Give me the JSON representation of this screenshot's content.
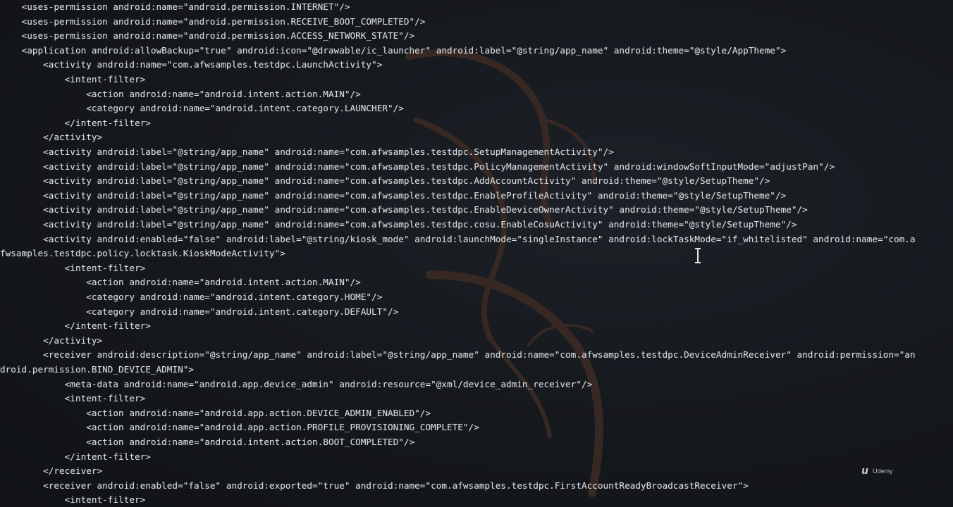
{
  "terminal": {
    "lines": [
      "    <uses-permission android:name=\"android.permission.INTERNET\"/>",
      "    <uses-permission android:name=\"android.permission.RECEIVE_BOOT_COMPLETED\"/>",
      "    <uses-permission android:name=\"android.permission.ACCESS_NETWORK_STATE\"/>",
      "    <application android:allowBackup=\"true\" android:icon=\"@drawable/ic_launcher\" android:label=\"@string/app_name\" android:theme=\"@style/AppTheme\">",
      "        <activity android:name=\"com.afwsamples.testdpc.LaunchActivity\">",
      "            <intent-filter>",
      "                <action android:name=\"android.intent.action.MAIN\"/>",
      "                <category android:name=\"android.intent.category.LAUNCHER\"/>",
      "            </intent-filter>",
      "        </activity>",
      "        <activity android:label=\"@string/app_name\" android:name=\"com.afwsamples.testdpc.SetupManagementActivity\"/>",
      "        <activity android:label=\"@string/app_name\" android:name=\"com.afwsamples.testdpc.PolicyManagementActivity\" android:windowSoftInputMode=\"adjustPan\"/>",
      "        <activity android:label=\"@string/app_name\" android:name=\"com.afwsamples.testdpc.AddAccountActivity\" android:theme=\"@style/SetupTheme\"/>",
      "        <activity android:label=\"@string/app_name\" android:name=\"com.afwsamples.testdpc.EnableProfileActivity\" android:theme=\"@style/SetupTheme\"/>",
      "        <activity android:label=\"@string/app_name\" android:name=\"com.afwsamples.testdpc.EnableDeviceOwnerActivity\" android:theme=\"@style/SetupTheme\"/>",
      "        <activity android:label=\"@string/app_name\" android:name=\"com.afwsamples.testdpc.cosu.EnableCosuActivity\" android:theme=\"@style/SetupTheme\"/>",
      "        <activity android:enabled=\"false\" android:label=\"@string/kiosk_mode\" android:launchMode=\"singleInstance\" android:lockTaskMode=\"if_whitelisted\" android:name=\"com.a",
      "fwsamples.testdpc.policy.locktask.KioskModeActivity\">",
      "            <intent-filter>",
      "                <action android:name=\"android.intent.action.MAIN\"/>",
      "                <category android:name=\"android.intent.category.HOME\"/>",
      "                <category android:name=\"android.intent.category.DEFAULT\"/>",
      "            </intent-filter>",
      "        </activity>",
      "        <receiver android:description=\"@string/app_name\" android:label=\"@string/app_name\" android:name=\"com.afwsamples.testdpc.DeviceAdminReceiver\" android:permission=\"an",
      "droid.permission.BIND_DEVICE_ADMIN\">",
      "            <meta-data android:name=\"android.app.device_admin\" android:resource=\"@xml/device_admin_receiver\"/>",
      "            <intent-filter>",
      "                <action android:name=\"android.app.action.DEVICE_ADMIN_ENABLED\"/>",
      "                <action android:name=\"android.app.action.PROFILE_PROVISIONING_COMPLETE\"/>",
      "                <action android:name=\"android.intent.action.BOOT_COMPLETED\"/>",
      "            </intent-filter>",
      "        </receiver>",
      "        <receiver android:enabled=\"false\" android:exported=\"true\" android:name=\"com.afwsamples.testdpc.FirstAccountReadyBroadcastReceiver\">",
      "            <intent-filter>"
    ]
  },
  "badge": {
    "text": "Udemy",
    "icon": "udemy-logo-icon"
  },
  "colors": {
    "background": "#14171c",
    "text": "#d9dde2",
    "watermark": "#3a2a26"
  },
  "overlay": {
    "cursor_icon": "text-ibeam-cursor-icon",
    "watermark_icon": "kali-dragon-icon"
  }
}
